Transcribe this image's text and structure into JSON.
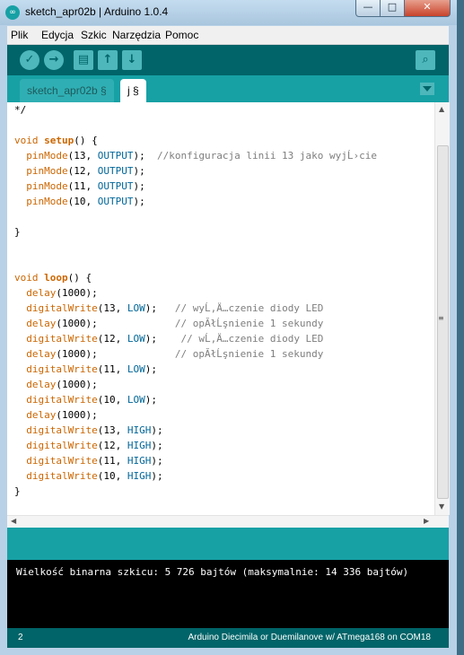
{
  "window": {
    "title": "sketch_apr02b | Arduino 1.0.4",
    "app_icon": "∞",
    "controls": {
      "minimize": "—",
      "maximize": "□",
      "close": "✕"
    }
  },
  "menu": {
    "items": [
      "Plik",
      "Edycja",
      "Szkic",
      "Narzędzia",
      "Pomoc"
    ]
  },
  "toolbar": {
    "verify_icon": "✓",
    "upload_icon": "→",
    "new_icon": "▤",
    "open_icon": "↑",
    "save_icon": "↓",
    "serial_icon": "⌕"
  },
  "tabs": [
    {
      "label": "sketch_apr02b §"
    },
    {
      "label": "j §"
    }
  ],
  "editor": {
    "lines": [
      [
        {
          "t": "*/",
          "c": "plain"
        }
      ],
      [],
      [
        {
          "t": "void ",
          "c": "kw"
        },
        {
          "t": "setup",
          "c": "kwb"
        },
        {
          "t": "() {",
          "c": "plain"
        }
      ],
      [
        {
          "t": "  ",
          "c": "plain"
        },
        {
          "t": "pinMode",
          "c": "kw"
        },
        {
          "t": "(13, ",
          "c": "plain"
        },
        {
          "t": "OUTPUT",
          "c": "cst"
        },
        {
          "t": ");  ",
          "c": "plain"
        },
        {
          "t": "//konfiguracja linii 13 jako wyjĹ›cie",
          "c": "cmt"
        }
      ],
      [
        {
          "t": "  ",
          "c": "plain"
        },
        {
          "t": "pinMode",
          "c": "kw"
        },
        {
          "t": "(12, ",
          "c": "plain"
        },
        {
          "t": "OUTPUT",
          "c": "cst"
        },
        {
          "t": ");",
          "c": "plain"
        }
      ],
      [
        {
          "t": "  ",
          "c": "plain"
        },
        {
          "t": "pinMode",
          "c": "kw"
        },
        {
          "t": "(11, ",
          "c": "plain"
        },
        {
          "t": "OUTPUT",
          "c": "cst"
        },
        {
          "t": ");",
          "c": "plain"
        }
      ],
      [
        {
          "t": "  ",
          "c": "plain"
        },
        {
          "t": "pinMode",
          "c": "kw"
        },
        {
          "t": "(10, ",
          "c": "plain"
        },
        {
          "t": "OUTPUT",
          "c": "cst"
        },
        {
          "t": ");",
          "c": "plain"
        }
      ],
      [],
      [
        {
          "t": "}",
          "c": "plain"
        }
      ],
      [],
      [],
      [
        {
          "t": "void ",
          "c": "kw"
        },
        {
          "t": "loop",
          "c": "kwb"
        },
        {
          "t": "() {",
          "c": "plain"
        }
      ],
      [
        {
          "t": "  ",
          "c": "plain"
        },
        {
          "t": "delay",
          "c": "kw"
        },
        {
          "t": "(1000);",
          "c": "plain"
        }
      ],
      [
        {
          "t": "  ",
          "c": "plain"
        },
        {
          "t": "digitalWrite",
          "c": "kw"
        },
        {
          "t": "(13, ",
          "c": "plain"
        },
        {
          "t": "LOW",
          "c": "cst"
        },
        {
          "t": ");   ",
          "c": "plain"
        },
        {
          "t": "// wyĹ‚Ä…czenie diody LED",
          "c": "cmt"
        }
      ],
      [
        {
          "t": "  ",
          "c": "plain"
        },
        {
          "t": "delay",
          "c": "kw"
        },
        {
          "t": "(1000);             ",
          "c": "plain"
        },
        {
          "t": "// opĂłĹşnienie 1 sekundy",
          "c": "cmt"
        }
      ],
      [
        {
          "t": "  ",
          "c": "plain"
        },
        {
          "t": "digitalWrite",
          "c": "kw"
        },
        {
          "t": "(12, ",
          "c": "plain"
        },
        {
          "t": "LOW",
          "c": "cst"
        },
        {
          "t": ");    ",
          "c": "plain"
        },
        {
          "t": "// wĹ‚Ä…czenie diody LED",
          "c": "cmt"
        }
      ],
      [
        {
          "t": "  ",
          "c": "plain"
        },
        {
          "t": "delay",
          "c": "kw"
        },
        {
          "t": "(1000);             ",
          "c": "plain"
        },
        {
          "t": "// opĂłĹşnienie 1 sekundy",
          "c": "cmt"
        }
      ],
      [
        {
          "t": "  ",
          "c": "plain"
        },
        {
          "t": "digitalWrite",
          "c": "kw"
        },
        {
          "t": "(11, ",
          "c": "plain"
        },
        {
          "t": "LOW",
          "c": "cst"
        },
        {
          "t": ");",
          "c": "plain"
        }
      ],
      [
        {
          "t": "  ",
          "c": "plain"
        },
        {
          "t": "delay",
          "c": "kw"
        },
        {
          "t": "(1000);",
          "c": "plain"
        }
      ],
      [
        {
          "t": "  ",
          "c": "plain"
        },
        {
          "t": "digitalWrite",
          "c": "kw"
        },
        {
          "t": "(10, ",
          "c": "plain"
        },
        {
          "t": "LOW",
          "c": "cst"
        },
        {
          "t": ");",
          "c": "plain"
        }
      ],
      [
        {
          "t": "  ",
          "c": "plain"
        },
        {
          "t": "delay",
          "c": "kw"
        },
        {
          "t": "(1000);",
          "c": "plain"
        }
      ],
      [
        {
          "t": "  ",
          "c": "plain"
        },
        {
          "t": "digitalWrite",
          "c": "kw"
        },
        {
          "t": "(13, ",
          "c": "plain"
        },
        {
          "t": "HIGH",
          "c": "cst"
        },
        {
          "t": ");",
          "c": "plain"
        }
      ],
      [
        {
          "t": "  ",
          "c": "plain"
        },
        {
          "t": "digitalWrite",
          "c": "kw"
        },
        {
          "t": "(12, ",
          "c": "plain"
        },
        {
          "t": "HIGH",
          "c": "cst"
        },
        {
          "t": ");",
          "c": "plain"
        }
      ],
      [
        {
          "t": "  ",
          "c": "plain"
        },
        {
          "t": "digitalWrite",
          "c": "kw"
        },
        {
          "t": "(11, ",
          "c": "plain"
        },
        {
          "t": "HIGH",
          "c": "cst"
        },
        {
          "t": ");",
          "c": "plain"
        }
      ],
      [
        {
          "t": "  ",
          "c": "plain"
        },
        {
          "t": "digitalWrite",
          "c": "kw"
        },
        {
          "t": "(10, ",
          "c": "plain"
        },
        {
          "t": "HIGH",
          "c": "cst"
        },
        {
          "t": ");",
          "c": "plain"
        }
      ],
      [
        {
          "t": "}",
          "c": "plain"
        }
      ]
    ],
    "scroll": {
      "up": "▲",
      "down": "▼",
      "left": "◀",
      "right": "▶",
      "grip": "≡"
    }
  },
  "console": {
    "message": "Wielkość binarna szkicu: 5 726 bajtów (maksymalnie: 14 336 bajtów)"
  },
  "footer": {
    "line_number": "2",
    "board": "Arduino Diecimila or Duemilanove w/ ATmega168 on COM18"
  },
  "colors": {
    "toolbar": "#006468",
    "tabbar": "#17a1a5",
    "keyword": "#cc6600",
    "constant": "#006699",
    "comment": "#7e7e7e"
  }
}
